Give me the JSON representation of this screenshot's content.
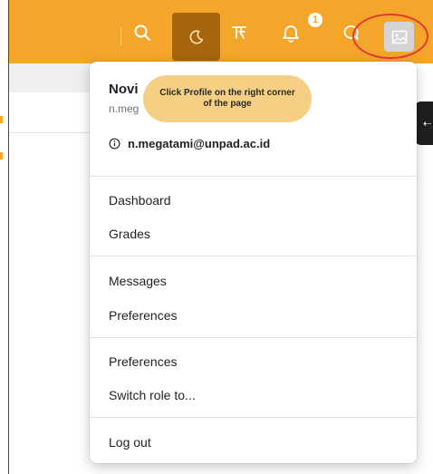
{
  "topbar": {
    "accent_color": "#f4a62a",
    "icons": [
      "search-icon",
      "moon-icon",
      "accessibility-icon",
      "bell-icon",
      "chat-icon",
      "avatar-image-icon"
    ],
    "notification_count": "1"
  },
  "side_tab": {
    "icon": "arrow-left-icon",
    "glyph": "⇠"
  },
  "dropdown": {
    "user_name": "Novi",
    "user_email_short": "n.meg",
    "user_email": "n.megatami@unpad.ac.id",
    "info_icon": "info-icon",
    "tooltip": "Click Profile on the right corner of the page",
    "items": [
      {
        "label": "Dashboard"
      },
      {
        "label": "Grades"
      },
      {
        "label": "Messages"
      },
      {
        "label": "Preferences"
      },
      {
        "label": "Preferences"
      },
      {
        "label": "Switch role to..."
      },
      {
        "label": "Log out"
      }
    ]
  }
}
